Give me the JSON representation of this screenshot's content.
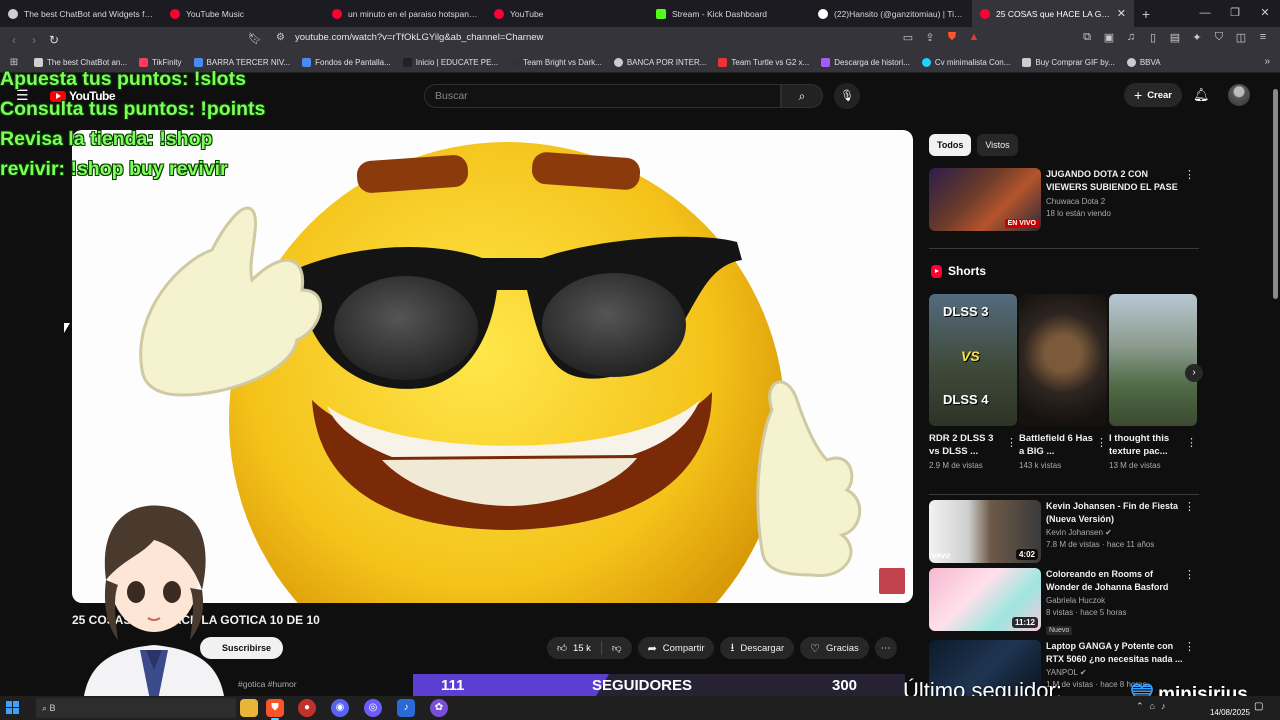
{
  "browser": {
    "tabs": [
      {
        "title": "The best ChatBot and Widgets for K",
        "color": "#cfcfcf"
      },
      {
        "title": "YouTube Music",
        "color": "#ff0033"
      },
      {
        "title": "un minuto en el paraiso hotspanish",
        "color": "#ff0033"
      },
      {
        "title": "YouTube",
        "color": "#ff0033"
      },
      {
        "title": "Stream - Kick Dashboard",
        "color": "#53fc18"
      },
      {
        "title": "(22)Hansito (@ganzitomiau) | TikTok",
        "color": "#ffffff"
      },
      {
        "title": "25 COSAS que HACE LA GOTICA",
        "color": "#ff0033"
      }
    ],
    "active_tab_index": 6,
    "url": "youtube.com/watch?v=rTfOkLGYilg&ab_channel=Charnew",
    "bookmarks": [
      {
        "label": "The best ChatBot an...",
        "color": "#cfcfcf"
      },
      {
        "label": "TikFinity",
        "color": "#ff3b5c"
      },
      {
        "label": "BARRA TERCER NIV...",
        "color": "#4a8af4"
      },
      {
        "label": "Fondos de Pantalla...",
        "color": "#4a8af4"
      },
      {
        "label": "Inicio | EDUCATE PE...",
        "color": "#222222"
      },
      {
        "label": "Team Bright vs Dark...",
        "color": "#333333"
      },
      {
        "label": "BANCA POR INTER...",
        "color": "#cccccc"
      },
      {
        "label": "Team Turtle vs G2 x...",
        "color": "#e33"
      },
      {
        "label": "Descarga de histori...",
        "color": "#a35cff"
      },
      {
        "label": "Cv minimalista Con...",
        "color": "#1fd1ff"
      },
      {
        "label": "Buy Comprar GIF by...",
        "color": "#cccccc"
      },
      {
        "label": "BBVA",
        "color": "#cccccc"
      }
    ]
  },
  "youtube": {
    "logo_text": "YouTube",
    "search_placeholder": "Buscar",
    "create_label": "Crear",
    "video": {
      "title": "25 COSAS QUE HACE LA GOTICA 10 DE 10",
      "subscribe_label": "Suscribirse",
      "likes": "15 k",
      "share_label": "Compartir",
      "download_label": "Descargar",
      "thanks_label": "Gracias",
      "hashtags": "#gotica #humor"
    },
    "chips": [
      "Todos",
      "Vistos"
    ],
    "live_rec": {
      "title": "JUGANDO DOTA 2 CON VIEWERS SUBIENDO EL PASE ...",
      "channel": "Chuwaca Dota 2",
      "stats": "18 lo están viendo",
      "badge": "EN VIVO"
    },
    "shorts_header": "Shorts",
    "shorts": [
      {
        "title": "RDR 2 DLSS 3 vs DLSS ...",
        "views": "2.9 M de vistas",
        "thumb_text_a": "DLSS 3",
        "thumb_text_b": "VS",
        "thumb_text_c": "DLSS 4"
      },
      {
        "title": "Battlefield 6 Has a BIG ...",
        "views": "143 k vistas"
      },
      {
        "title": "I thought this texture pac...",
        "views": "13 M de vistas"
      }
    ],
    "recs": [
      {
        "title": "Kevin Johansen - Fin de Fiesta (Nueva Versión)",
        "channel": "Kevin Johansen",
        "stats": "7.8 M de vistas · hace 11 años",
        "duration": "4:02",
        "thumb_label": "vevo"
      },
      {
        "title": "Coloreando en Rooms of Wonder de Johanna Basford",
        "channel": "Gabriela Huczok",
        "stats": "8 vistas · hace 5 horas",
        "duration": "11:12",
        "badge": "Nuevo"
      },
      {
        "title": "Laptop GANGA y Potente con RTX 5060 ¿no necesitas nada ...",
        "channel": "YANPOL",
        "stats": "1 M de vistas · hace 8 horas"
      }
    ]
  },
  "overlay": {
    "commands": [
      "Apuesta tus puntos: !slots",
      "Consulta tus puntos: !points",
      "Revisa la tienda: !shop",
      "revivir: !shop buy revivir"
    ],
    "follower_current": "111",
    "follower_label": "SEGUIDORES",
    "follower_goal": "300",
    "follower_progress": 0.37,
    "last_follower_label": "Último seguidor:",
    "last_follower_name": "minisirius"
  },
  "taskbar": {
    "search_text": "B",
    "date": "14/08/2025"
  },
  "colors": {
    "youtube_red": "#ff0000",
    "overlay_green": "#7cff5a",
    "follow_bar_purple": "#5b3fd1"
  }
}
